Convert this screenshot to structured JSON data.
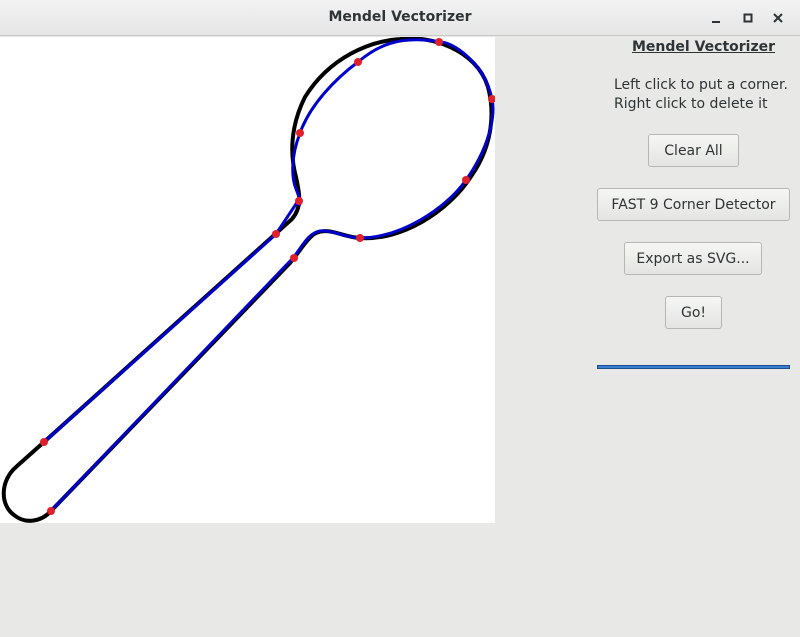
{
  "window": {
    "title": "Mendel Vectorizer",
    "minimize_icon": "minimize-icon",
    "maximize_icon": "maximize-icon",
    "close_icon": "close-icon"
  },
  "panel": {
    "heading": "Mendel Vectorizer",
    "instruction_line1": "Left click to put a corner.",
    "instruction_line2": "Right click to delete it",
    "buttons": {
      "clear_all": "Clear All",
      "fast9": "FAST 9 Corner Detector",
      "export_svg": "Export as SVG...",
      "go": "Go!"
    },
    "progress": 1.0
  },
  "colors": {
    "outline": "#000000",
    "vector_path": "#0000cc",
    "corner_point": "#e0202a",
    "progress_fill": "#3b7ed0"
  }
}
